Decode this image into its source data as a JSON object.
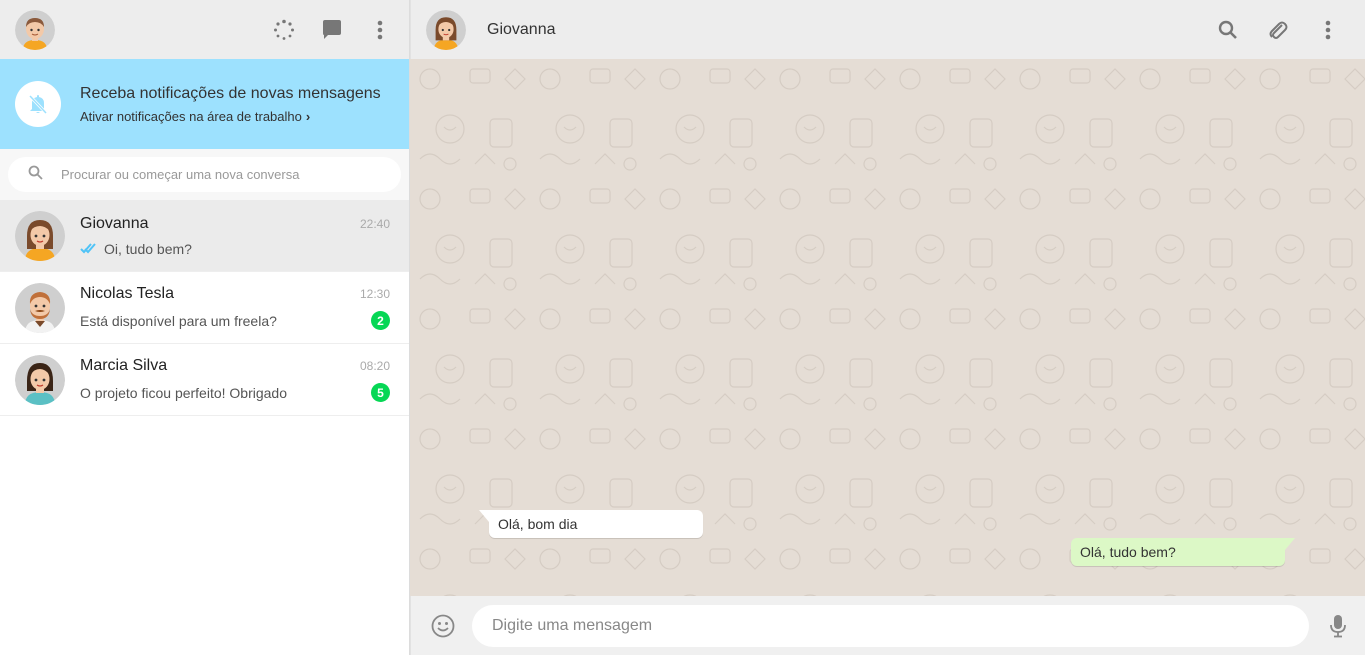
{
  "colors": {
    "header_bg": "#ededed",
    "notification_bg": "#9de1fe",
    "badge_green": "#06d755",
    "outgoing_bubble": "#dcf8c6",
    "conversation_bg": "#e5ddd5",
    "read_tick": "#4fc3f7"
  },
  "left_header": {
    "icons": [
      "status-icon",
      "new-chat-icon",
      "menu-icon"
    ]
  },
  "notification": {
    "title": "Receba notificações de novas mensagens",
    "link": "Ativar notificações na área de trabalho",
    "icon": "bell-off-icon"
  },
  "search": {
    "placeholder": "Procurar ou começar uma nova conversa"
  },
  "chats": [
    {
      "name": "Giovanna",
      "time": "22:40",
      "message": "Oi, tudo bem?",
      "read": true,
      "unread": null,
      "active": true
    },
    {
      "name": "Nicolas Tesla",
      "time": "12:30",
      "message": "Está disponível para um freela?",
      "unread": "2"
    },
    {
      "name": "Marcia Silva",
      "time": "08:20",
      "message": "O projeto ficou perfeito! Obrigado",
      "unread": "5"
    }
  ],
  "conversation": {
    "contact_name": "Giovanna",
    "header_icons": [
      "search-icon",
      "attach-icon",
      "menu-icon"
    ],
    "messages": [
      {
        "direction": "in",
        "text": "Olá, bom dia"
      },
      {
        "direction": "out",
        "text": "Olá, tudo bem?"
      }
    ]
  },
  "composer": {
    "placeholder": "Digite uma mensagem",
    "icons": [
      "emoji-icon",
      "microphone-icon"
    ]
  }
}
